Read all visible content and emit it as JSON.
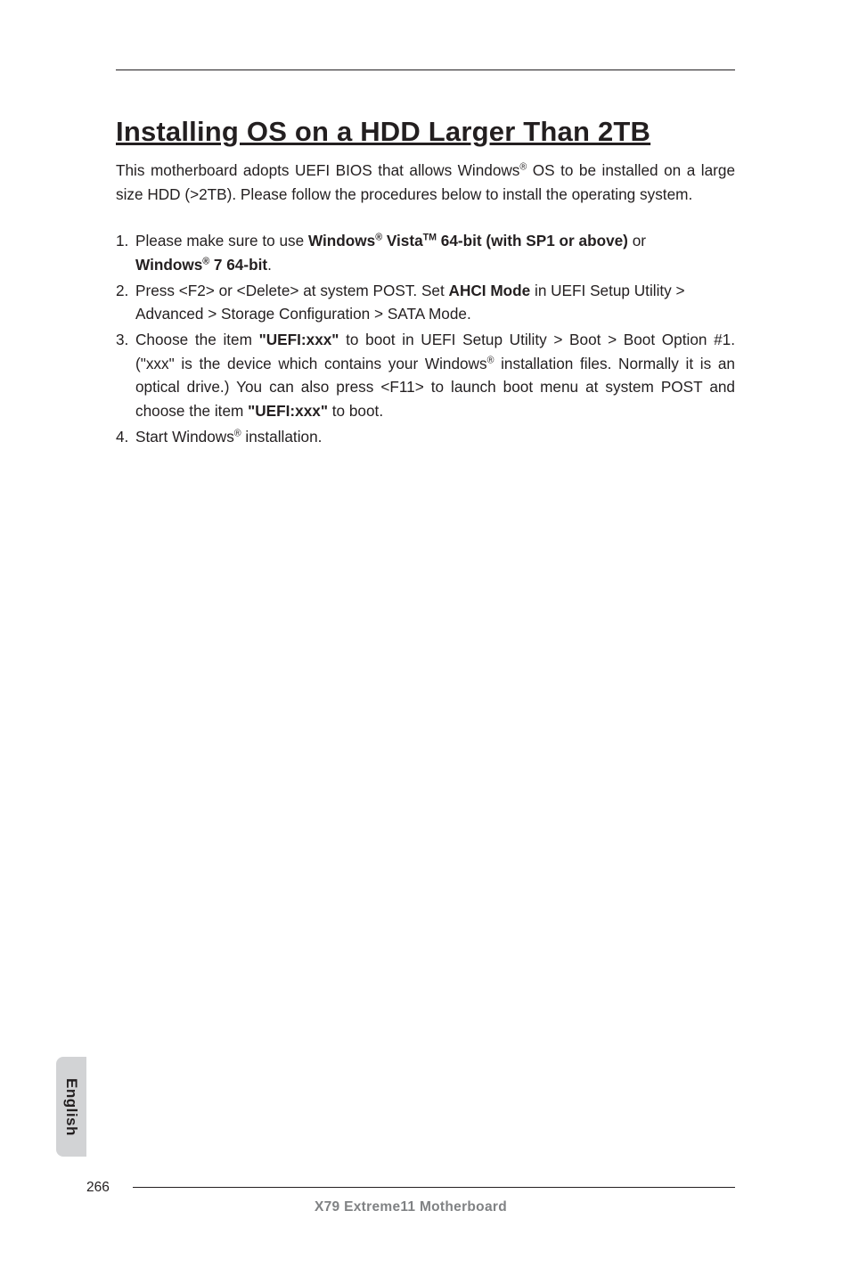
{
  "title": "Installing OS on a HDD Larger Than 2TB",
  "intro": {
    "p1a": "This motherboard adopts UEFI BIOS that allows Windows",
    "p1b": " OS to be installed on a large size HDD (>2TB). Please follow the procedures below to install the operating system.",
    "reg": "®"
  },
  "steps": {
    "s1": {
      "num": "1.",
      "a": "Please make sure to use ",
      "b1": "Windows",
      "b_reg": "®",
      "b2": " Vista",
      "b_tm": "TM",
      "b3": " 64-bit (with SP1 or above)",
      "c": " or ",
      "d1": "Windows",
      "d_reg": "®",
      "d2": " 7 64-bit",
      "e": "."
    },
    "s2": {
      "num": "2.",
      "a": "Press <F2> or <Delete> at system POST. Set ",
      "b": "AHCI Mode",
      "c": " in UEFI Setup Utility > Advanced > Storage Configuration > SATA Mode."
    },
    "s3": {
      "num": "3.",
      "a": "Choose the item ",
      "b": "\"UEFI:xxx\"",
      "c": " to boot in UEFI Setup Utility > Boot > Boot Option #1. (\"xxx\" is the device which contains your Windows",
      "reg": "®",
      "d": " installation files. Normally it is an optical drive.) You can also press <F11> to launch boot menu at system POST and choose the item ",
      "e": "\"UEFI:xxx\"",
      "f": " to boot."
    },
    "s4": {
      "num": "4.",
      "a": "Start Windows",
      "reg": "®",
      "b": " installation."
    }
  },
  "sidebar": "English",
  "footer": {
    "page": "266",
    "title": "X79  Extreme11  Motherboard"
  }
}
